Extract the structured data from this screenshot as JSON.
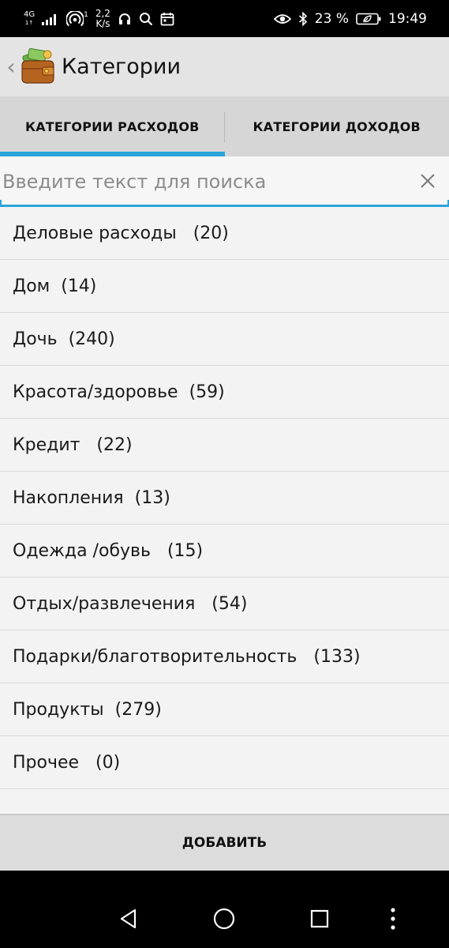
{
  "status_bar": {
    "network_type": "4G",
    "network_sub": "1↑",
    "hotspot_count": "1",
    "speed_value": "2,2",
    "speed_unit": "K/s",
    "battery_percent": "23 %",
    "time": "19:49"
  },
  "toolbar": {
    "title": "Категории"
  },
  "tabs": [
    {
      "label": "КАТЕГОРИИ РАСХОДОВ",
      "active": true
    },
    {
      "label": "КАТЕГОРИИ ДОХОДОВ",
      "active": false
    }
  ],
  "search": {
    "placeholder": "Введите текст для поиска",
    "value": ""
  },
  "categories": [
    {
      "label": "Деловые расходы   (20)"
    },
    {
      "label": "Дом  (14)"
    },
    {
      "label": "Дочь  (240)"
    },
    {
      "label": "Красота/здоровье  (59)"
    },
    {
      "label": "Кредит   (22)"
    },
    {
      "label": "Накопления  (13)"
    },
    {
      "label": "Одежда /обувь   (15)"
    },
    {
      "label": "Отдых/развлечения   (54)"
    },
    {
      "label": "Подарки/благотворительность   (133)"
    },
    {
      "label": "Продукты  (279)"
    },
    {
      "label": "Прочее   (0)"
    }
  ],
  "add_button": {
    "label": "ДОБАВИТЬ"
  },
  "colors": {
    "accent": "#2aa4d9",
    "toolbar_bg": "#e4e4e4",
    "tab_bg": "#d6d6d6",
    "list_bg": "#f3f3f3"
  }
}
